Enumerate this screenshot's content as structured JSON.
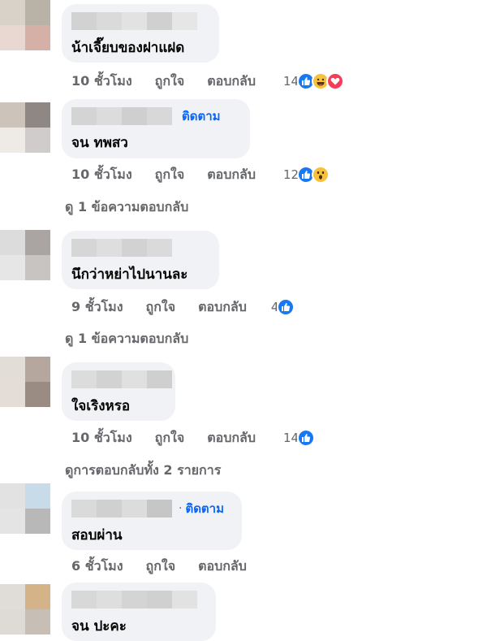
{
  "comments": [
    {
      "text": "น้าเจี๊ยบของฝาแฝด",
      "time": "10 ชั้วโมง",
      "like_label": "ถูกใจ",
      "reply_label": "ตอบกลับ",
      "reaction_count": "14",
      "reactions": [
        "like-icon",
        "haha-icon",
        "love-icon"
      ],
      "follow": ""
    },
    {
      "text": "จน ทพสว",
      "time": "10 ชั้วโมง",
      "like_label": "ถูกใจ",
      "reply_label": "ตอบกลับ",
      "reaction_count": "12",
      "reactions": [
        "like-icon",
        "wow-icon"
      ],
      "follow": "ติดตาม",
      "view_replies": "ดู 1 ข้อความตอบกลับ"
    },
    {
      "text": "นึกว่าหย่าไปนานละ",
      "time": "9 ชั้วโมง",
      "like_label": "ถูกใจ",
      "reply_label": "ตอบกลับ",
      "reaction_count": "4",
      "reactions": [
        "like-icon"
      ],
      "follow": "",
      "view_replies": "ดู 1 ข้อความตอบกลับ"
    },
    {
      "text": "ใจเริงหรอ",
      "time": "10 ชั้วโมง",
      "like_label": "ถูกใจ",
      "reply_label": "ตอบกลับ",
      "reaction_count": "14",
      "reactions": [
        "like-icon"
      ],
      "follow": "",
      "view_replies": "ดูการตอบกลับทั้ง 2 รายการ"
    },
    {
      "text": "สอบผ่าน",
      "time": "6 ชั้วโมง",
      "like_label": "ถูกใจ",
      "reply_label": "ตอบกลับ",
      "follow": "ติดตาม",
      "dot": "·"
    },
    {
      "text": "จน ปะคะ",
      "follow": ""
    }
  ],
  "colors": {
    "bubble": "#f0f2f5",
    "link": "#0866ff",
    "meta": "#65676b",
    "like": "#1877f2"
  }
}
